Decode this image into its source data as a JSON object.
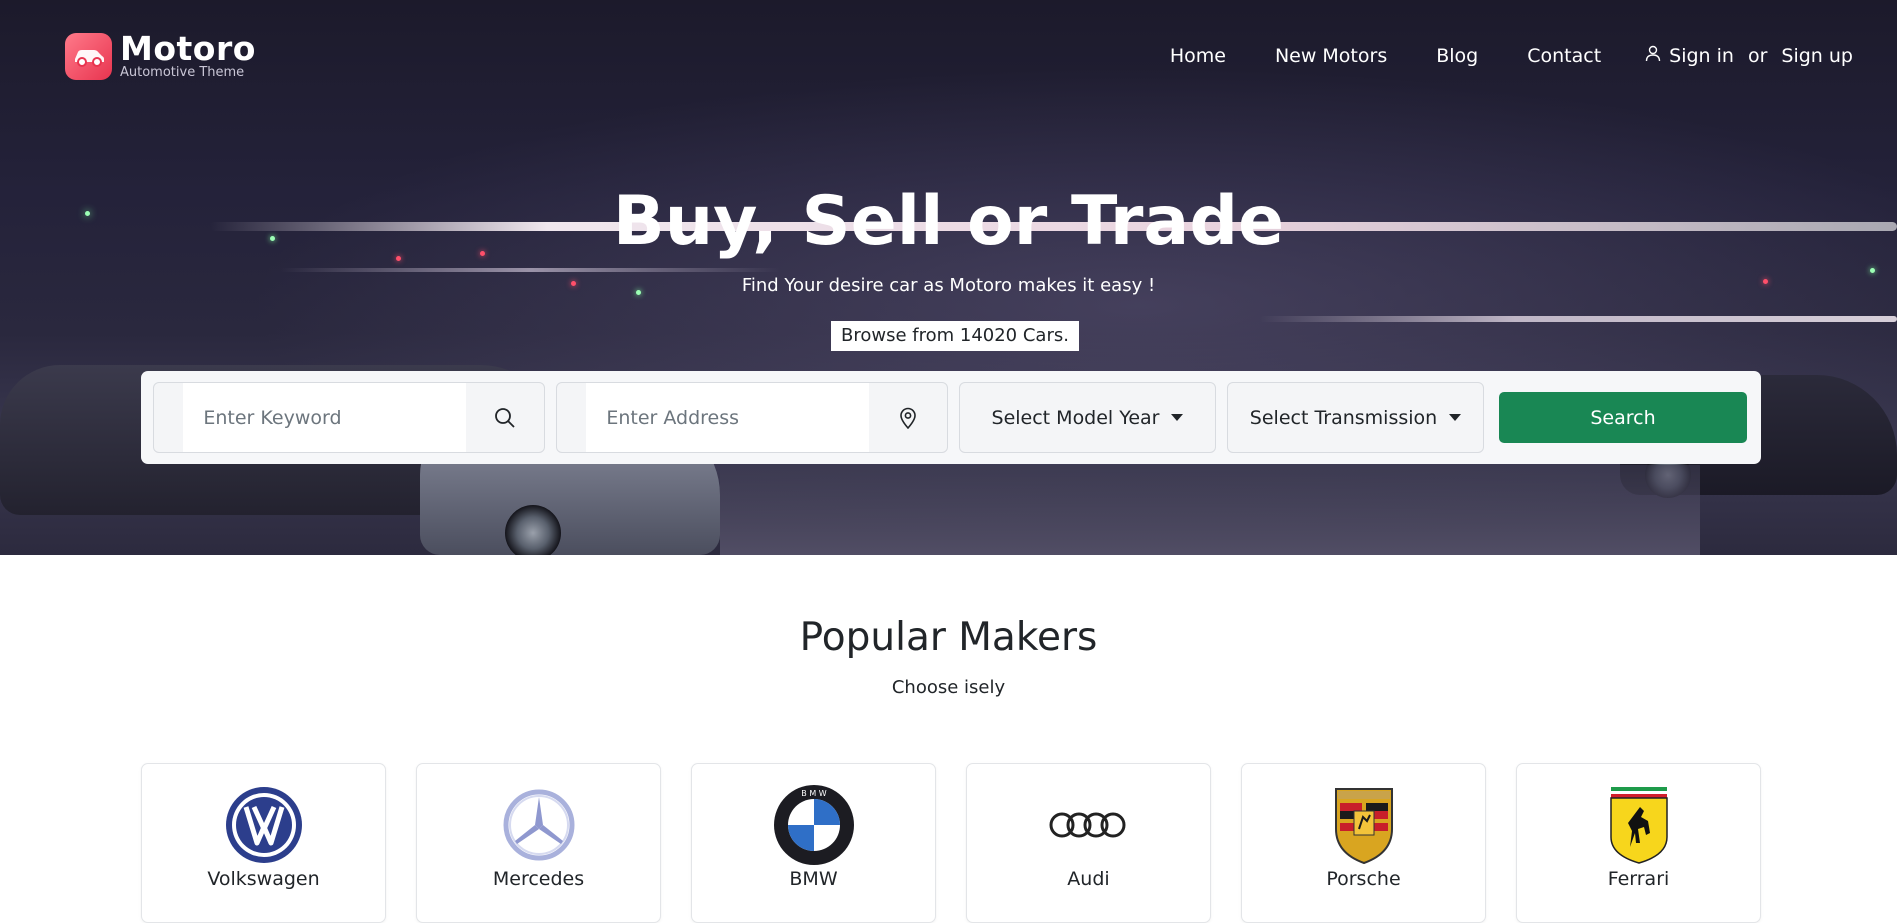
{
  "brand": {
    "name": "Motoro",
    "tagline": "Automotive Theme"
  },
  "nav": {
    "items": [
      "Home",
      "New Motors",
      "Blog",
      "Contact"
    ],
    "sign_in": "Sign in",
    "or": "or",
    "sign_up": "Sign up"
  },
  "hero": {
    "title": "Buy, Sell or Trade",
    "subtitle": "Find Your desire car as Motoro makes it easy !",
    "browse": "Browse from 14020 Cars."
  },
  "search": {
    "keyword_placeholder": "Enter Keyword",
    "address_placeholder": "Enter Address",
    "model_year": "Select Model Year",
    "transmission": "Select Transmission",
    "button": "Search"
  },
  "makers": {
    "title": "Popular Makers",
    "subtitle": "Choose isely",
    "items": [
      {
        "name": "Volkswagen",
        "icon": "volkswagen-logo-icon"
      },
      {
        "name": "Mercedes",
        "icon": "mercedes-logo-icon"
      },
      {
        "name": "BMW",
        "icon": "bmw-logo-icon"
      },
      {
        "name": "Audi",
        "icon": "audi-logo-icon"
      },
      {
        "name": "Porsche",
        "icon": "porsche-logo-icon"
      },
      {
        "name": "Ferrari",
        "icon": "ferrari-logo-icon"
      }
    ]
  },
  "colors": {
    "accent": "#198754",
    "brand": "#e8344f"
  }
}
